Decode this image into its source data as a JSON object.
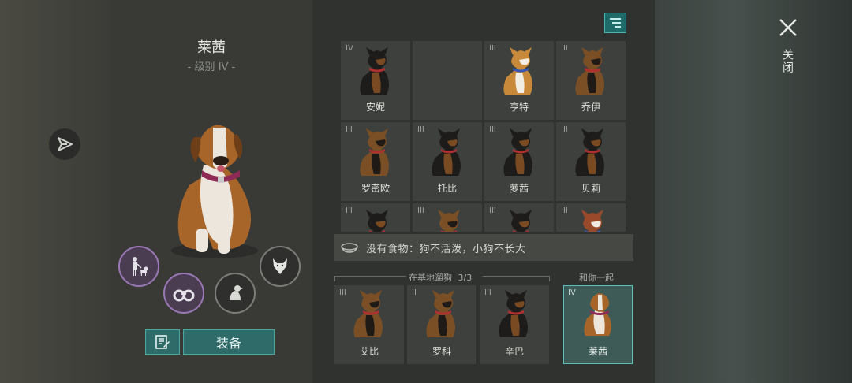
{
  "selected_dog": {
    "name": "莱茜",
    "level": "- 级别 IV -"
  },
  "buttons": {
    "equip": "装备"
  },
  "icons": {
    "send": "send-icon",
    "memo": "memo-icon",
    "filter": "filter-icon",
    "close": "close-icon",
    "food_bowl": "food-bowl-icon",
    "companion": "person-with-dog-icon",
    "scout": "binoculars-icon",
    "sit": "sitting-dog-icon",
    "wolf": "wolf-head-icon"
  },
  "kennel": [
    {
      "level": "IV",
      "name": "安妮",
      "breed": "rottweiler"
    },
    {
      "level": "",
      "name": "",
      "breed": "empty"
    },
    {
      "level": "III",
      "name": "亨特",
      "breed": "corgi"
    },
    {
      "level": "III",
      "name": "乔伊",
      "breed": "shepherd"
    },
    {
      "level": "III",
      "name": "罗密欧",
      "breed": "shepherd"
    },
    {
      "level": "III",
      "name": "托比",
      "breed": "rottweiler"
    },
    {
      "level": "III",
      "name": "萝茜",
      "breed": "rottweiler"
    },
    {
      "level": "III",
      "name": "贝莉",
      "breed": "rottweiler"
    },
    {
      "level": "III",
      "name": "",
      "breed": "rottweiler"
    },
    {
      "level": "III",
      "name": "",
      "breed": "shepherd"
    },
    {
      "level": "III",
      "name": "",
      "breed": "rottweiler"
    },
    {
      "level": "III",
      "name": "",
      "breed": "husky"
    }
  ],
  "food_warning": "没有食物：狗不活泼，小狗不长大",
  "walking": {
    "label": "在基地遛狗",
    "count": "3/3",
    "dogs": [
      {
        "level": "III",
        "name": "艾比",
        "breed": "shepherd"
      },
      {
        "level": "II",
        "name": "罗科",
        "breed": "shepherd"
      },
      {
        "level": "III",
        "name": "辛巴",
        "breed": "rottweiler"
      }
    ]
  },
  "with_you": {
    "label": "和你一起",
    "dog": {
      "level": "IV",
      "name": "莱茜",
      "breed": "saint-bernard"
    }
  },
  "close_label": "关闭",
  "colors": {
    "accent": "#2e6b69",
    "accent_border": "#4aa6a0",
    "active_ring": "#9a78b6"
  }
}
